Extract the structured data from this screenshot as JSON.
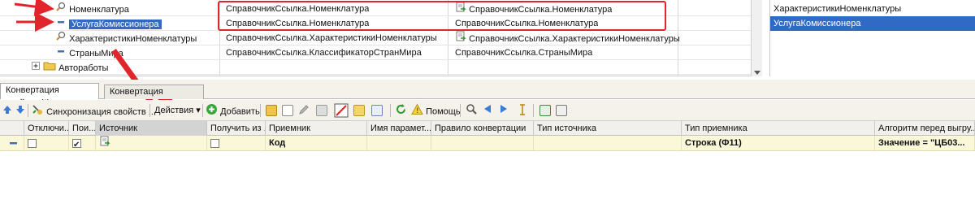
{
  "tree": {
    "rows": [
      {
        "name": "Номенклатура",
        "source_type": "СправочникСсылка.Номенклатура",
        "dest_type": "СправочникСсылка.Номенклатура"
      },
      {
        "name": "УслугаКомиссионера",
        "source_type": "СправочникСсылка.Номенклатура",
        "dest_type": "СправочникСсылка.Номенклатура"
      },
      {
        "name": "ХарактеристикиНоменклатуры",
        "source_type": "СправочникСсылка.ХарактеристикиНоменклатуры",
        "dest_type": "СправочникСсылка.ХарактеристикиНоменклатуры"
      },
      {
        "name": "СтраныМира",
        "source_type": "СправочникСсылка.КлассификаторСтранМира",
        "dest_type": "СправочникСсылка.СтраныМира"
      },
      {
        "name": "Автоработы",
        "source_type": "",
        "dest_type": ""
      }
    ]
  },
  "right_list": {
    "items": [
      "ХарактеристикиНоменклатуры",
      "УслугаКомиссионера"
    ]
  },
  "tabs": [
    {
      "label": "Конвертация свойств (*)"
    },
    {
      "label": "Конвертация значений"
    }
  ],
  "toolbar": {
    "sync_label": "Синхронизация свойств ...",
    "actions_label": "Действия",
    "add_label": "Добавить",
    "help_label": "Помощь"
  },
  "table": {
    "headers": [
      "Отключи...",
      "Пои...",
      "Источник",
      "Получить из ...",
      "Приемник",
      "Имя парамет...",
      "Правило конвертации",
      "Тип источника",
      "Тип приемника",
      "Алгоритм перед выгру..."
    ],
    "row": {
      "receiver": "Код",
      "dest_type": "Строка (Ф11)",
      "algorithm": "Значение = \"ЦБ03..."
    }
  },
  "colors": {
    "selection": "#316ac5",
    "annotation_red": "#e0262a",
    "row_highlight": "#fbf7d9"
  }
}
